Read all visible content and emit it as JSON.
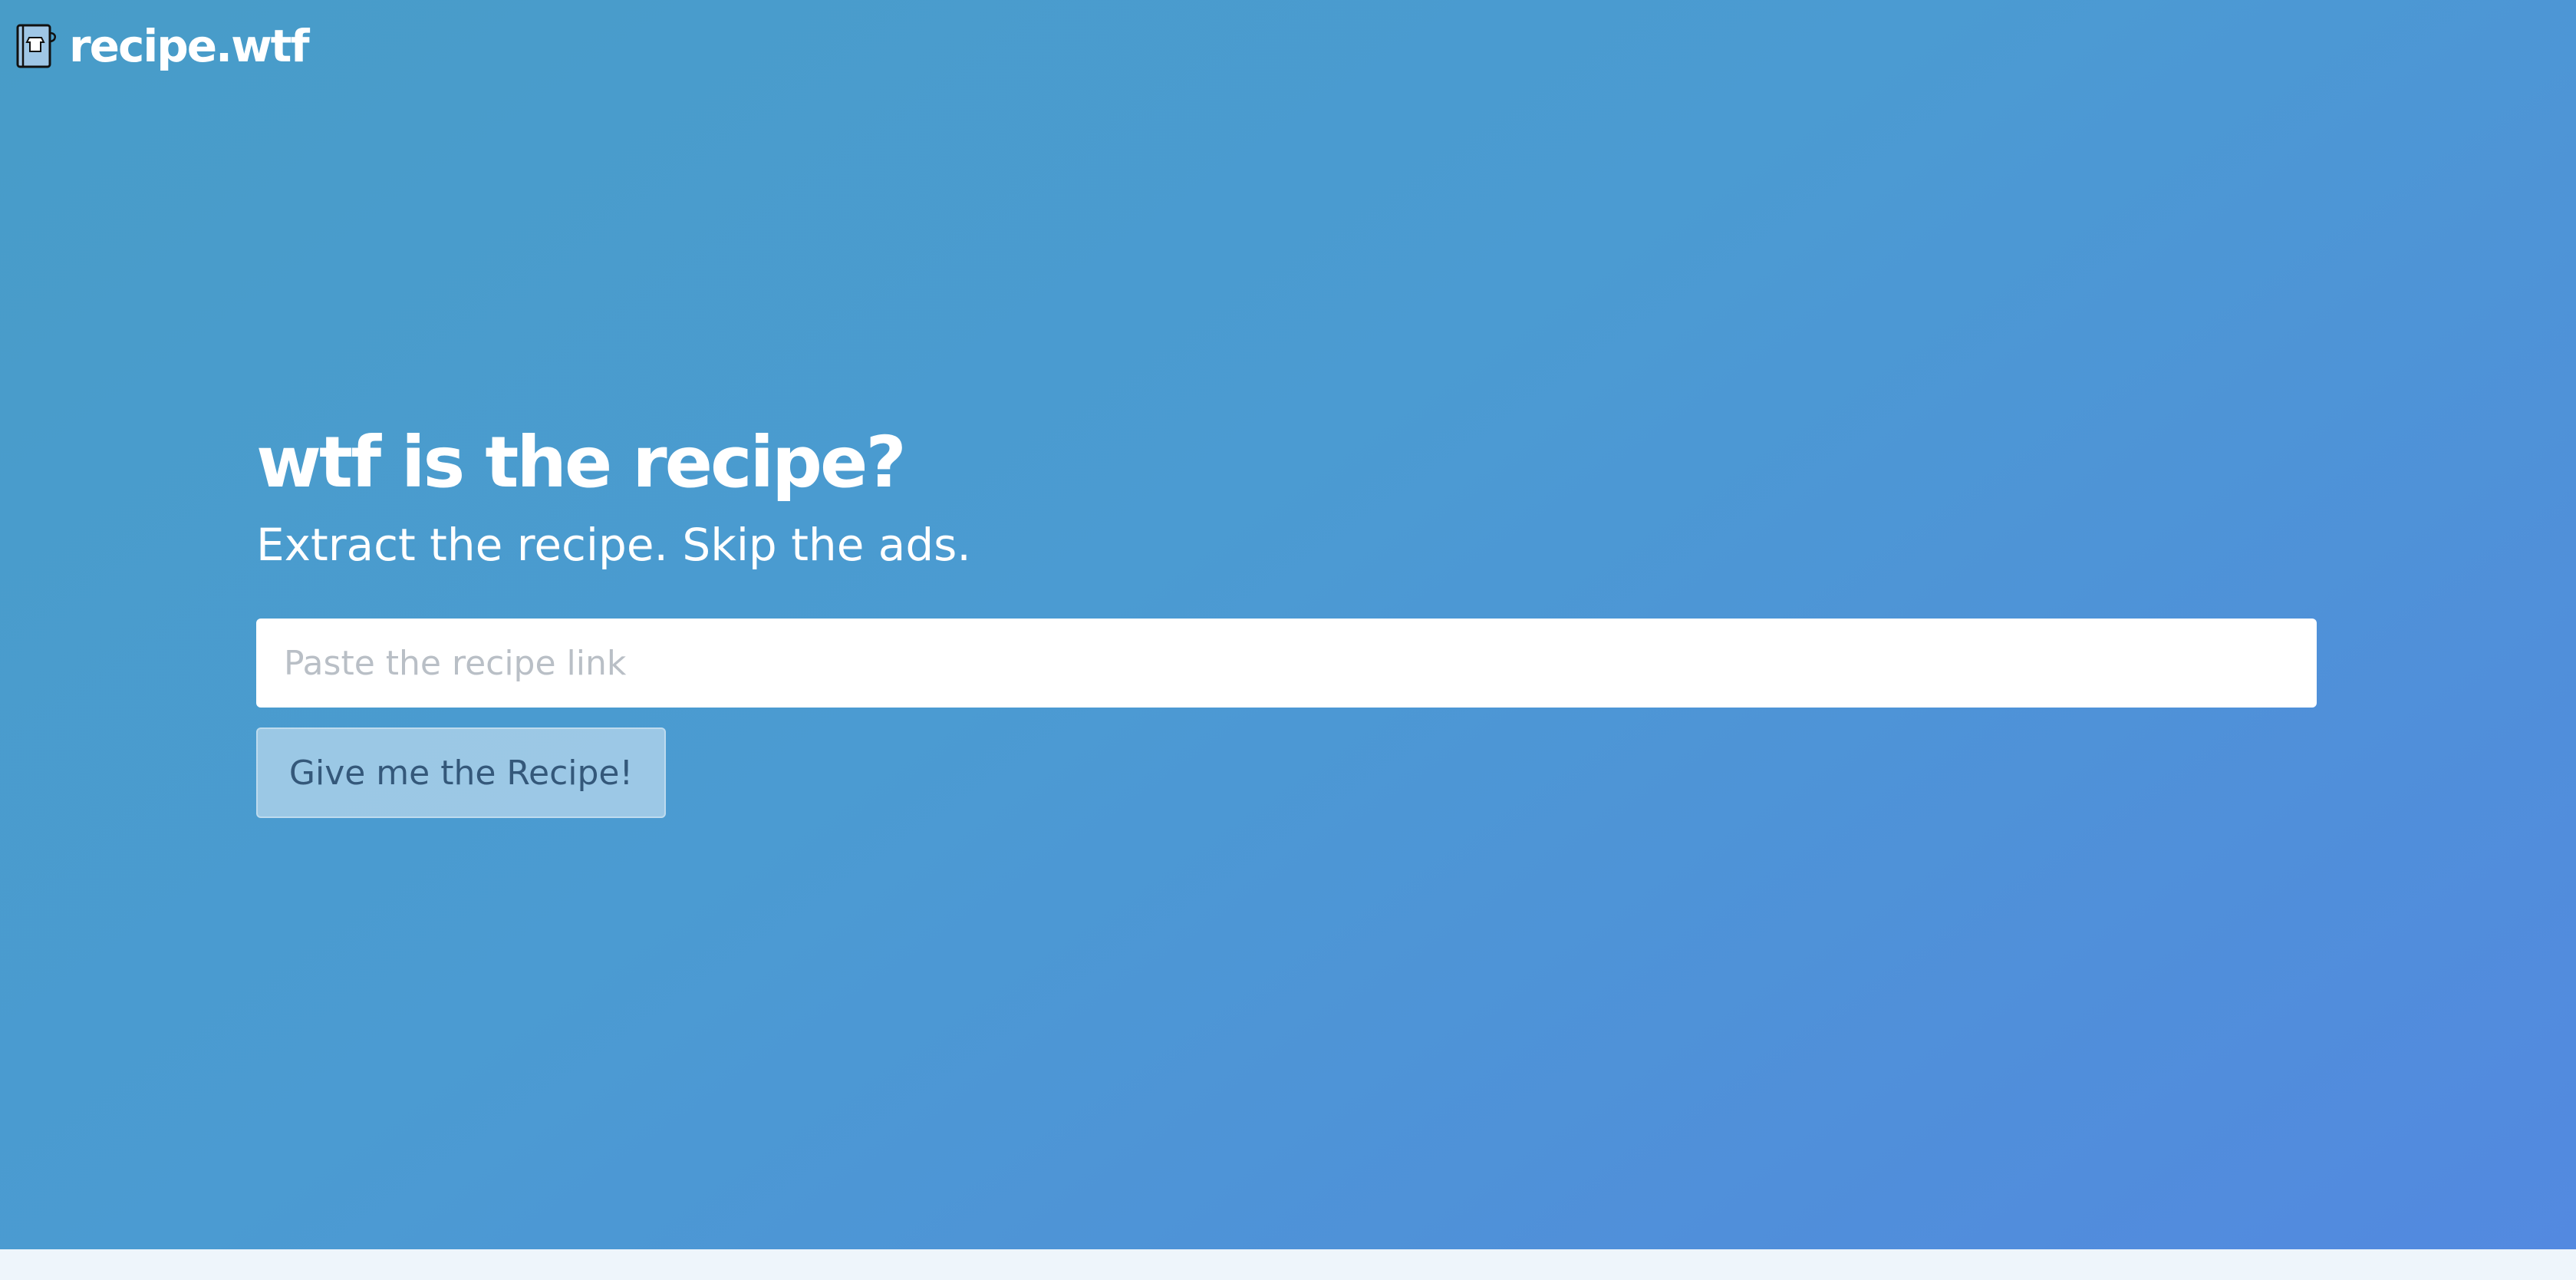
{
  "brand": {
    "name": "recipe.wtf",
    "icon": "recipe-book-icon"
  },
  "hero": {
    "headline": "wtf is the recipe?",
    "tagline": "Extract the recipe. Skip the ads."
  },
  "form": {
    "url_placeholder": "Paste the recipe link",
    "url_value": "",
    "submit_label": "Give me the Recipe!"
  },
  "colors": {
    "gradient_start": "#489cc8",
    "gradient_end": "#5389e0",
    "button_text": "#34587a",
    "footer_background": "#eef5fb"
  }
}
